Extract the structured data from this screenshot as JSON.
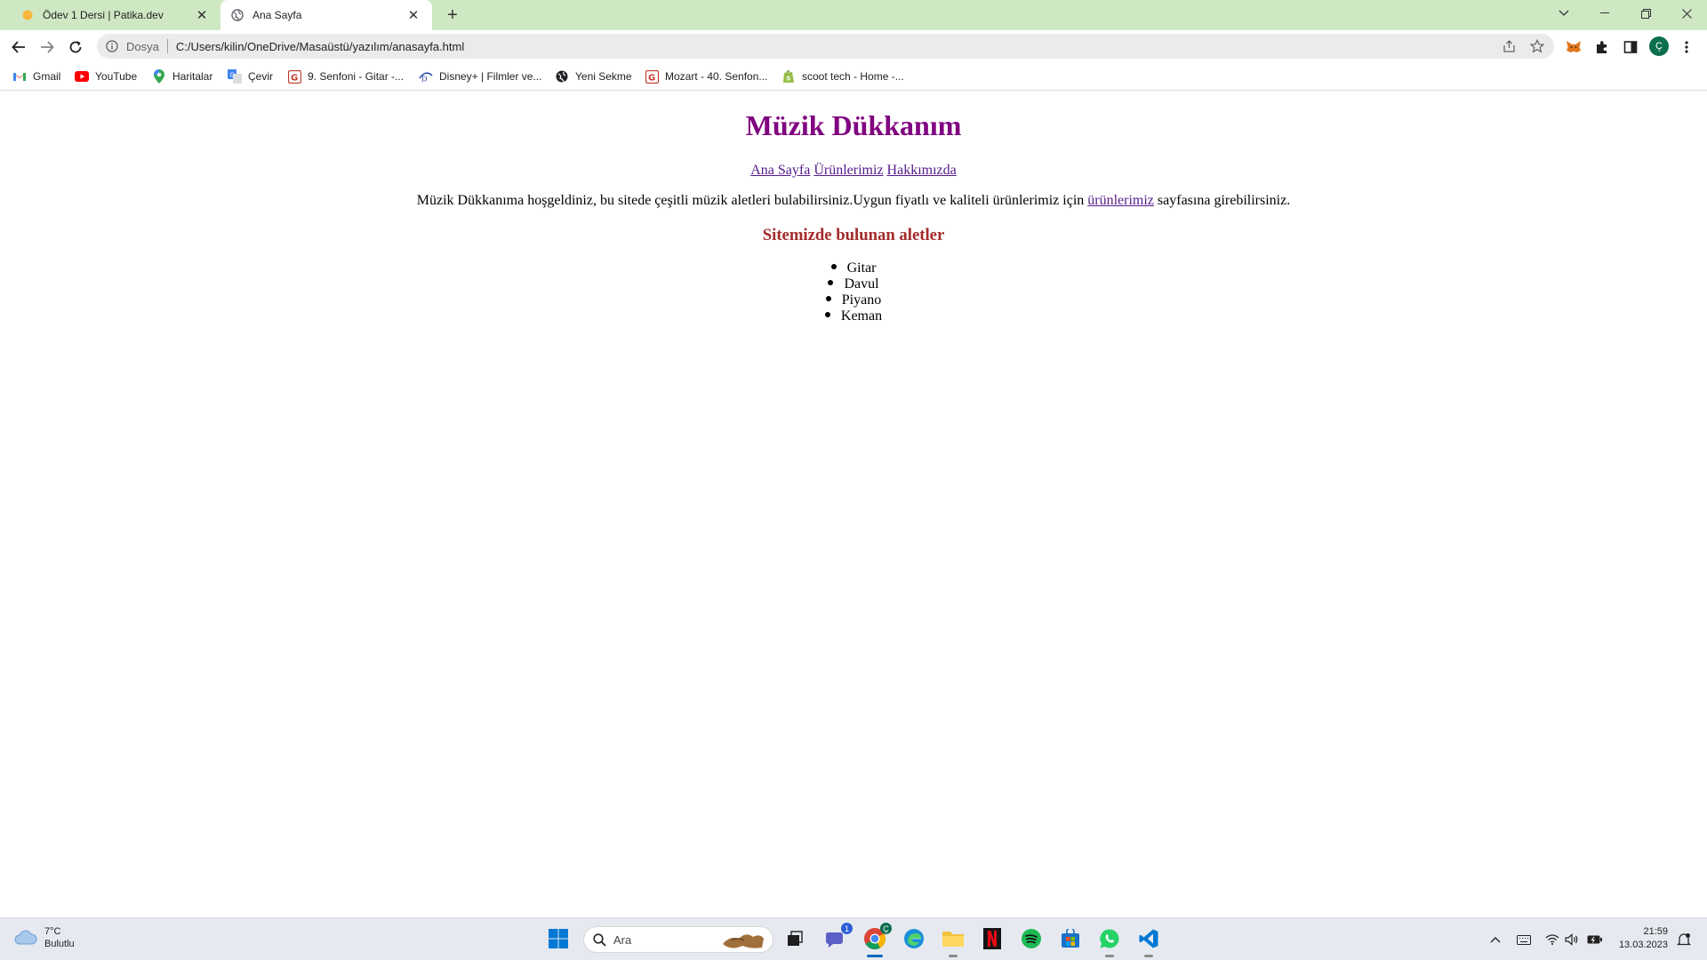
{
  "browser": {
    "tabs": [
      {
        "title": "Ödev 1 Dersi | Patika.dev",
        "icon": "patika-favicon",
        "active": false
      },
      {
        "title": "Ana Sayfa",
        "icon": "globe-icon",
        "active": true
      }
    ],
    "address": {
      "scheme_label": "Dosya",
      "url": "C:/Users/kilin/OneDrive/Masaüstü/yazılım/anasayfa.html"
    },
    "profile_initial": "Ç",
    "bookmarks": [
      {
        "label": "Gmail",
        "icon": "gmail-icon"
      },
      {
        "label": "YouTube",
        "icon": "youtube-icon"
      },
      {
        "label": "Haritalar",
        "icon": "maps-icon"
      },
      {
        "label": "Çevir",
        "icon": "translate-icon"
      },
      {
        "label": "9. Senfoni - Gitar -...",
        "icon": "guitar-site-icon"
      },
      {
        "label": "Disney+ | Filmler ve...",
        "icon": "disney-icon"
      },
      {
        "label": "Yeni Sekme",
        "icon": "globe-icon"
      },
      {
        "label": "Mozart - 40. Senfon...",
        "icon": "guitar-site-icon"
      },
      {
        "label": "scoot tech - Home -...",
        "icon": "shopify-icon"
      }
    ]
  },
  "page": {
    "title": "Müzik Dükkanım",
    "nav": [
      {
        "label": "Ana Sayfa"
      },
      {
        "label": "Ürünlerimiz"
      },
      {
        "label": "Hakkımızda"
      }
    ],
    "intro_before": "Müzik Dükkanıma hoşgeldiniz, bu sitede çeşitli müzik aletleri bulabilirsiniz.Uygun fiyatlı ve kaliteli ürünlerimiz için ",
    "intro_link": "ürünlerimiz",
    "intro_after": " sayfasına girebilirsiniz.",
    "subheading": "Sitemizde bulunan aletler",
    "instruments": [
      "Gitar",
      "Davul",
      "Piyano",
      "Keman"
    ],
    "colors": {
      "title": "#800080",
      "subheading": "#a52a2a",
      "link": "#551a8b"
    }
  },
  "taskbar": {
    "weather": {
      "temp": "7°C",
      "condition": "Bulutlu"
    },
    "search_placeholder": "Ara",
    "teams_badge": "1",
    "chrome_badge": "Ç",
    "clock": {
      "time": "21:59",
      "date": "13.03.2023"
    }
  }
}
